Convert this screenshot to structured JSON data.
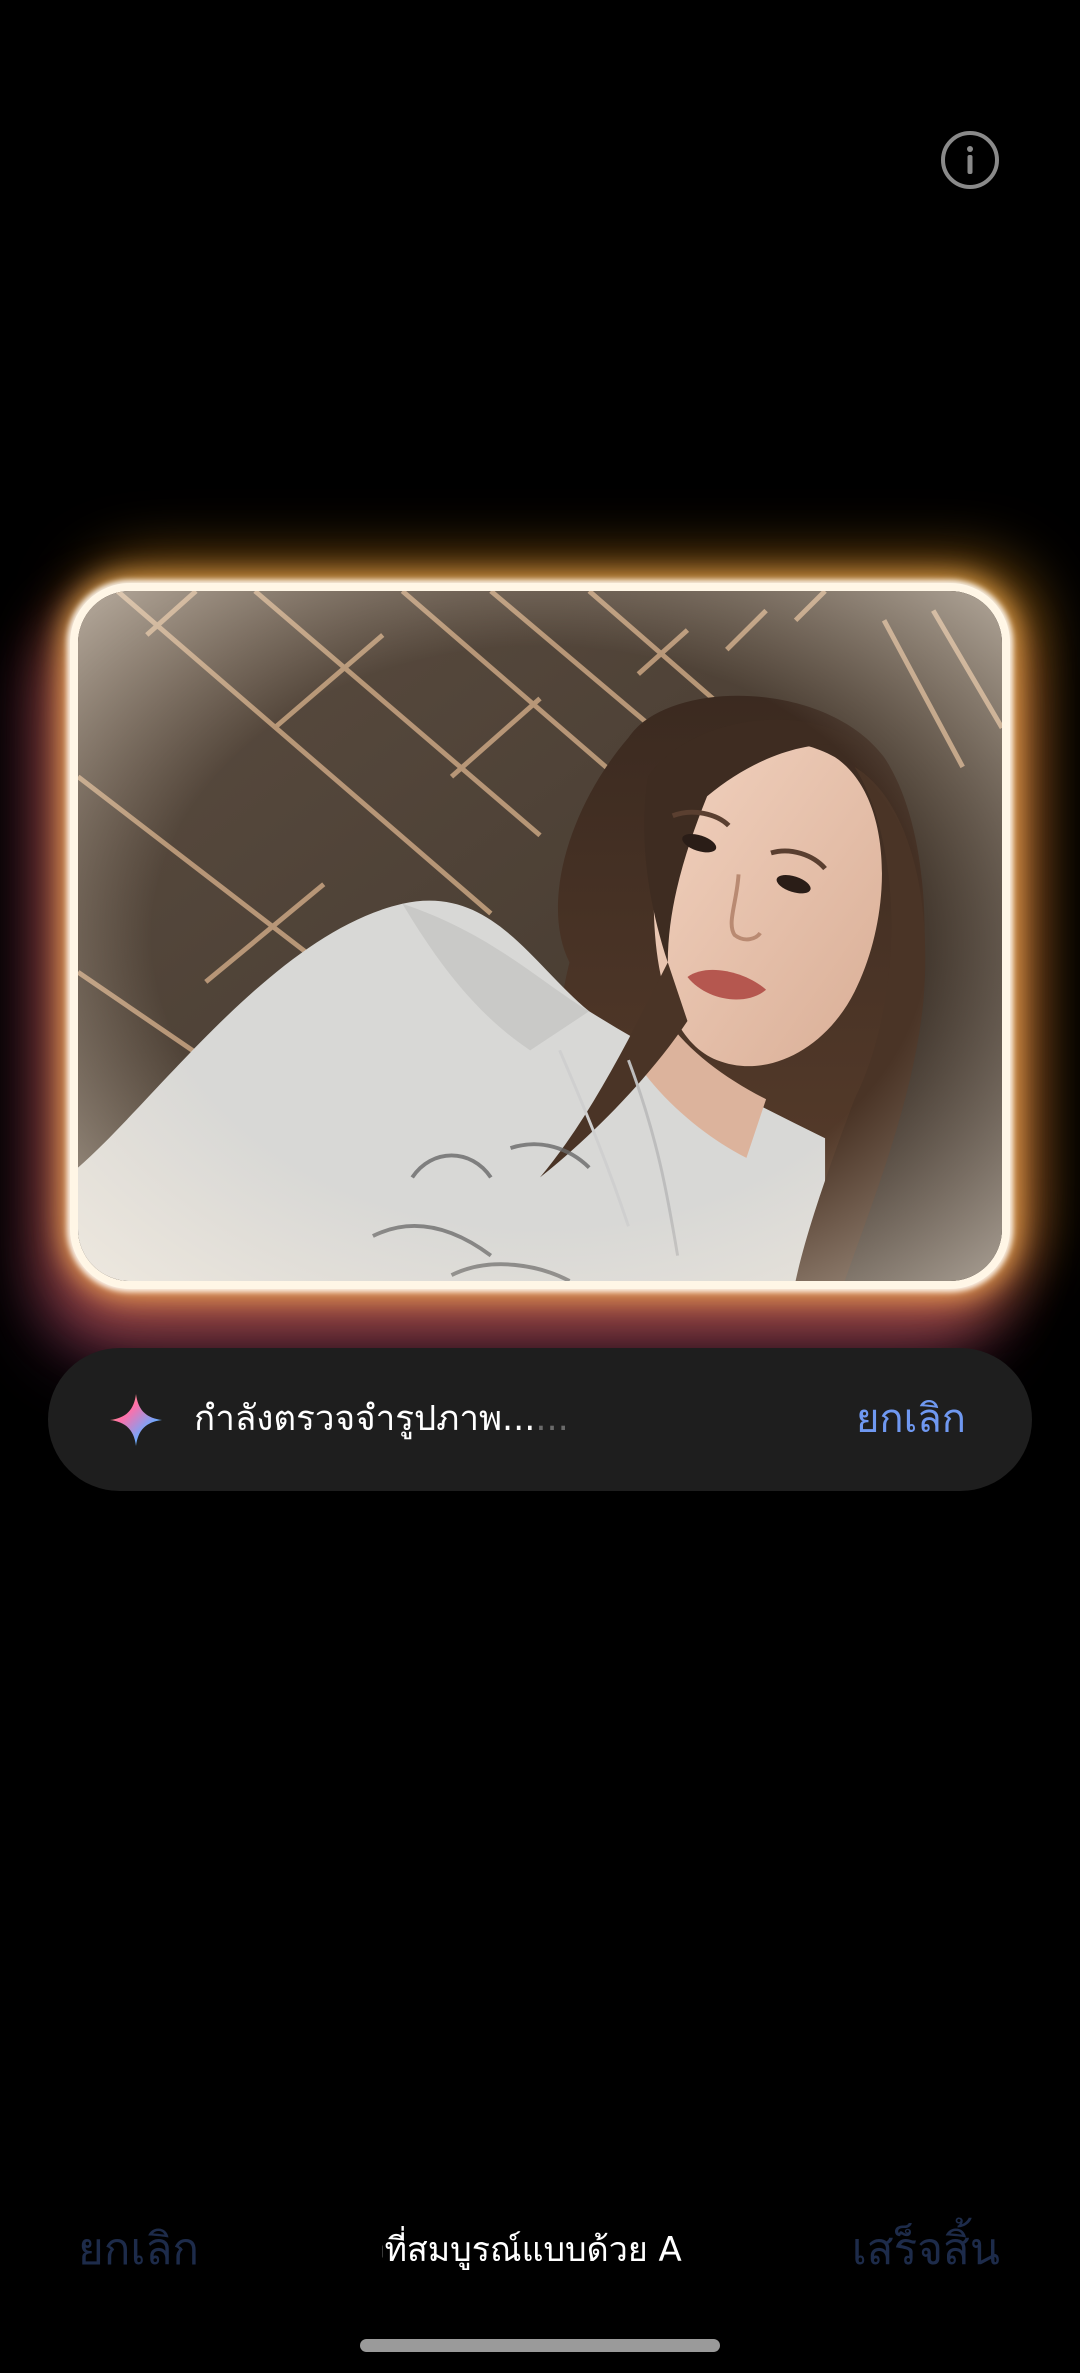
{
  "header": {
    "info_icon": "info-circle-icon"
  },
  "photo": {
    "description_icon": "portrait-photo",
    "glow_colors": [
      "#fff6e6",
      "#ffbe5a",
      "#ff7a5a",
      "#c850a0"
    ]
  },
  "status": {
    "icon": "ai-sparkle-icon",
    "text": "กำลังตรวจจำรูปภาพ...",
    "dots": "...",
    "cancel_label": "ยกเลิก",
    "cancel_color": "#6f98f1"
  },
  "bottom_bar": {
    "cancel_label": "ยกเลิก",
    "title_fragment": "งที่สมบูรณ์แบบด้วย A",
    "done_label": "เสร็จสิ้น",
    "disabled_color": "#1d2b4a"
  }
}
